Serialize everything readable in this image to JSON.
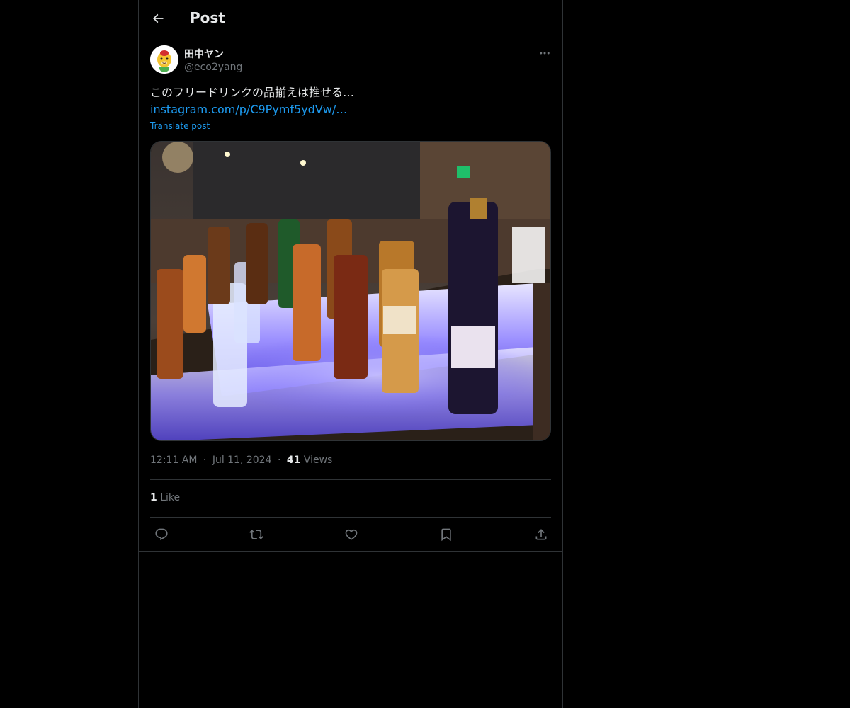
{
  "header": {
    "title": "Post",
    "back_icon": "arrow-left-icon"
  },
  "author": {
    "display_name": "田中ヤン",
    "handle": "@eco2yang",
    "avatar_icon": "cartoon-avatar"
  },
  "post": {
    "text": "このフリードリンクの品揃えは推せる…",
    "link": "instagram.com/p/C9Pymf5ydVw/…",
    "translate_label": "Translate post",
    "media_description_icon": "photo-liquor-bottles"
  },
  "meta": {
    "time": "12:11 AM",
    "separator": "·",
    "date": "Jul 11, 2024",
    "views_count": "41",
    "views_label": "Views"
  },
  "engagement": {
    "likes_count": "1",
    "likes_label": "Like"
  },
  "actions": {
    "reply_icon": "reply-icon",
    "repost_icon": "repost-icon",
    "like_icon": "heart-icon",
    "bookmark_icon": "bookmark-icon",
    "share_icon": "share-icon"
  },
  "colors": {
    "background": "#000000",
    "text": "#e7e9ea",
    "secondary": "#71767b",
    "accent": "#1d9bf0",
    "border": "#2f3336"
  }
}
